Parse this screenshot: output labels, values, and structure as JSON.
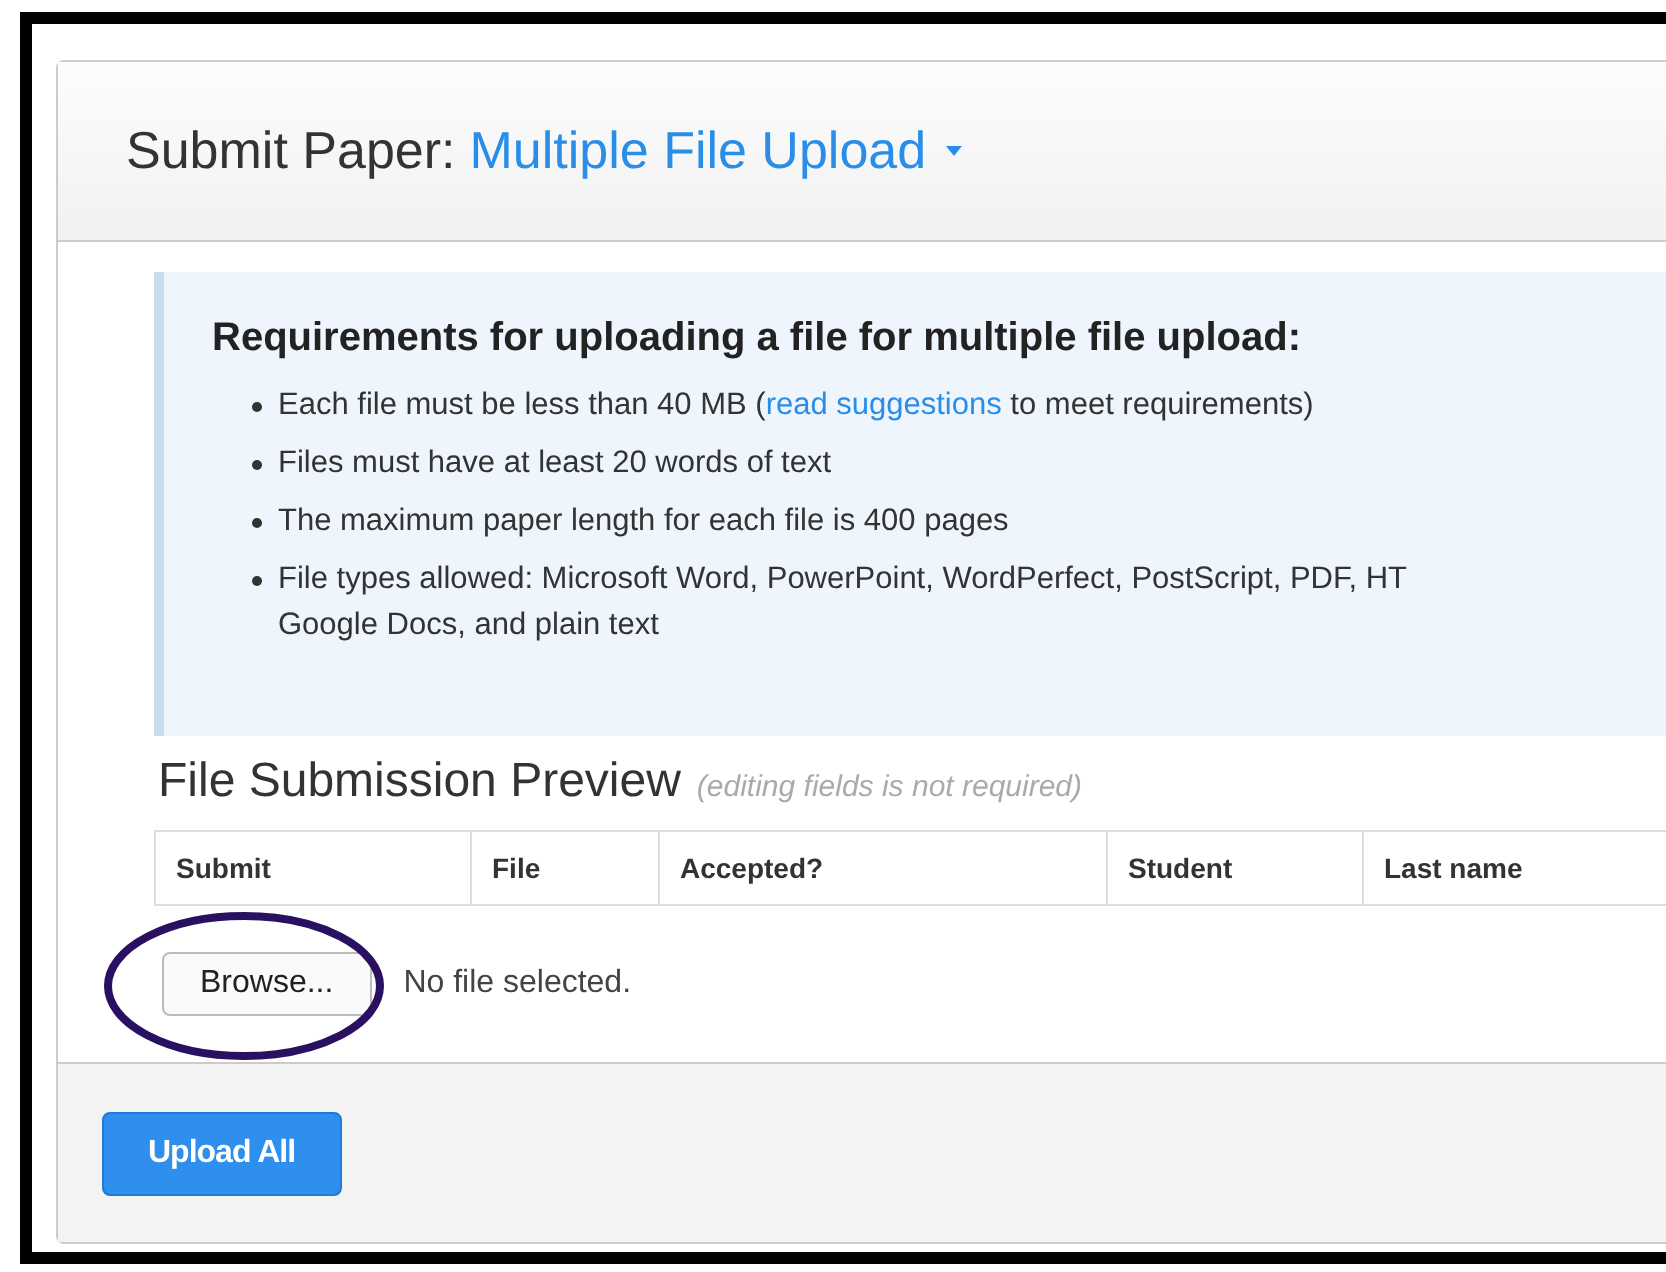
{
  "header": {
    "title": "Submit Paper:",
    "dropdown": "Multiple File Upload"
  },
  "requirements": {
    "heading": "Requirements for uploading a file for multiple file upload:",
    "items": [
      {
        "before": "Each file must be less than 40 MB (",
        "link": "read suggestions",
        "after": " to meet requirements)"
      },
      {
        "before": "Files must have at least 20 words of text"
      },
      {
        "before": "The maximum paper length for each file is 400 pages"
      },
      {
        "before": "File types allowed: Microsoft Word, PowerPoint, WordPerfect, PostScript, PDF, HT",
        "continuation": "Google Docs, and plain text"
      }
    ]
  },
  "preview": {
    "title": "File Submission Preview",
    "note": "(editing fields is not required)",
    "columns": [
      "Submit",
      "File",
      "Accepted?",
      "Student",
      "Last name"
    ]
  },
  "file_input": {
    "button": "Browse...",
    "status": "No file selected.",
    "circled": true
  },
  "footer": {
    "button": "Upload All"
  }
}
